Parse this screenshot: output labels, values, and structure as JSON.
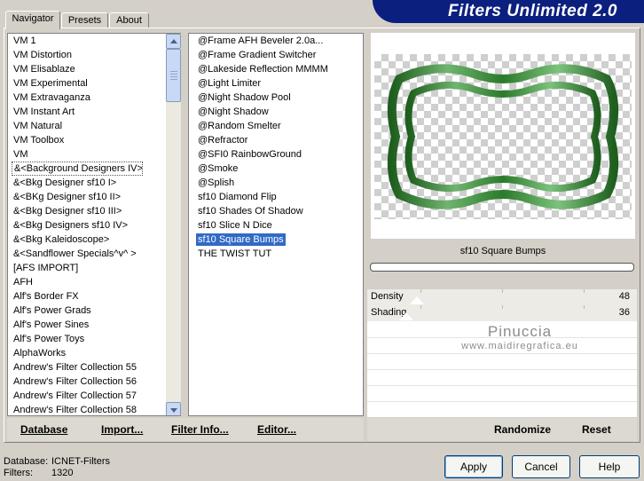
{
  "window": {
    "title": "Filters Unlimited 2.0"
  },
  "tabs": [
    {
      "label": "Navigator",
      "active": true
    },
    {
      "label": "Presets",
      "active": false
    },
    {
      "label": "About",
      "active": false
    }
  ],
  "categories": {
    "selected": "&<Background Designers IV>",
    "items": [
      "VM 1",
      "VM Distortion",
      "VM Elisablaze",
      "VM Experimental",
      "VM Extravaganza",
      "VM Instant Art",
      "VM Natural",
      "VM Toolbox",
      "VM",
      "&<Background Designers IV>",
      "&<Bkg Designer sf10 I>",
      "&<BKg Designer sf10 II>",
      "&<Bkg Designer sf10 III>",
      "&<Bkg Designers sf10 IV>",
      "&<Bkg Kaleidoscope>",
      "&<Sandflower Specials^v^ >",
      "[AFS IMPORT]",
      "AFH",
      "Alf's Border FX",
      "Alf's Power Grads",
      "Alf's Power Sines",
      "Alf's Power Toys",
      "AlphaWorks",
      "Andrew's Filter Collection 55",
      "Andrew's Filter Collection 56",
      "Andrew's Filter Collection 57",
      "Andrew's Filter Collection 58"
    ]
  },
  "filters": {
    "selected": "sf10 Square Bumps",
    "items": [
      "@Frame AFH Beveler 2.0a...",
      "@Frame Gradient Switcher",
      "@Lakeside Reflection MMMM",
      "@Light Limiter",
      "@Night Shadow Pool",
      "@Night Shadow",
      "@Random Smelter",
      "@Refractor",
      "@SFI0 RainbowGround",
      "@Smoke",
      "@Splish",
      "sf10 Diamond Flip",
      "sf10 Shades Of Shadow",
      "sf10 Slice N Dice",
      "sf10 Square Bumps",
      "THE TWIST TUT"
    ]
  },
  "preview": {
    "filter_name": "sf10 Square Bumps",
    "frame_color": "#3b8a3b"
  },
  "parameters": [
    {
      "label": "Density",
      "value": "48"
    },
    {
      "label": "Shading",
      "value": "36"
    }
  ],
  "watermark": {
    "line1": "Pinuccia",
    "line2": "www.maidiregrafica.eu"
  },
  "left_actions": {
    "database": "Database",
    "import": "Import...",
    "filter_info": "Filter Info...",
    "editor": "Editor..."
  },
  "right_actions": {
    "randomize": "Randomize",
    "reset": "Reset"
  },
  "status": {
    "database_label": "Database:",
    "database_value": "ICNET-Filters",
    "filters_label": "Filters:",
    "filters_value": "1320"
  },
  "buttons": {
    "apply": "Apply",
    "cancel": "Cancel",
    "help": "Help"
  }
}
